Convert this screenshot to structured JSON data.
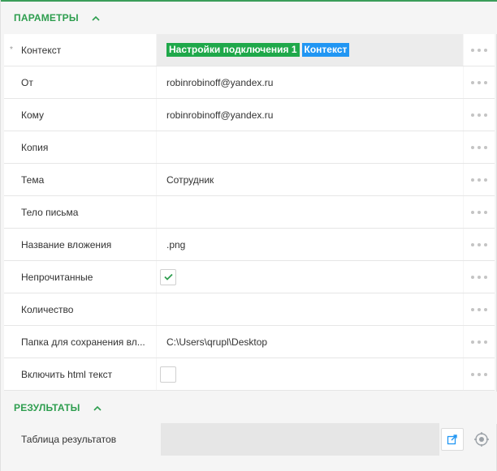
{
  "colors": {
    "accent_green": "#2e9e4f",
    "tag_green": "#1fa84a",
    "tag_blue": "#2196f3"
  },
  "parameters_section": {
    "title": "ПАРАМЕТРЫ",
    "expanded": true,
    "rows": [
      {
        "label": "Контекст",
        "required": true,
        "tags": [
          "Настройки подключения 1",
          "Контекст"
        ]
      },
      {
        "label": "От",
        "value": "robinrobinoff@yandex.ru"
      },
      {
        "label": "Кому",
        "value": "robinrobinoff@yandex.ru"
      },
      {
        "label": "Копия",
        "value": ""
      },
      {
        "label": "Тема",
        "value": "Сотрудник"
      },
      {
        "label": "Тело письма",
        "value": ""
      },
      {
        "label": "Название вложения",
        "value": ".png"
      },
      {
        "label": "Непрочитанные",
        "checked": true
      },
      {
        "label": "Количество",
        "value": ""
      },
      {
        "label": "Папка для сохранения вл...",
        "value": "C:\\Users\\qrupl\\Desktop"
      },
      {
        "label": "Включить html текст",
        "checked": false
      }
    ]
  },
  "results_section": {
    "title": "РЕЗУЛЬТАТЫ",
    "expanded": true,
    "rows": [
      {
        "label": "Таблица результатов",
        "value": ""
      }
    ]
  },
  "icons": {
    "chevron": "chevron-up-icon",
    "menu": "more-horizontal-icon",
    "check": "check-icon",
    "export": "export-icon",
    "target": "target-icon"
  }
}
